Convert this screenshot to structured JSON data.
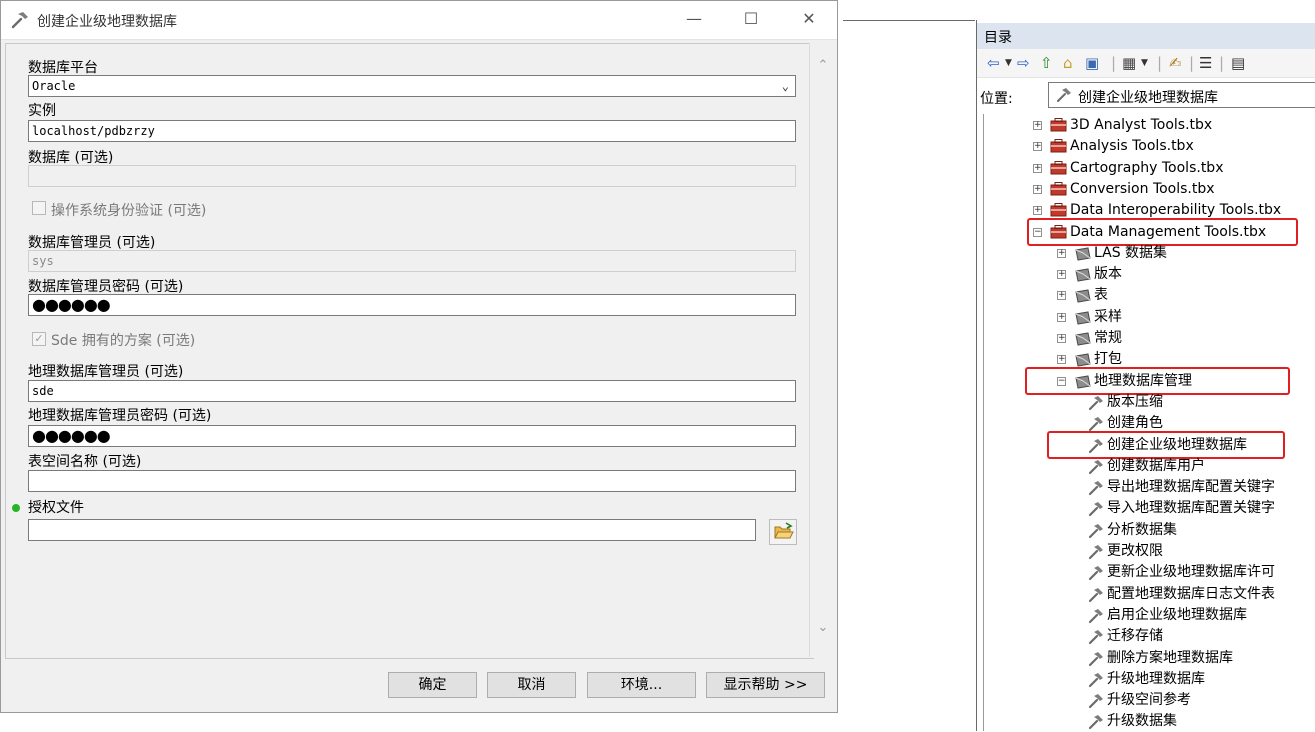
{
  "dialog": {
    "title": "创建企业级地理数据库",
    "window_buttons": [
      "—",
      "☐",
      "✕"
    ],
    "fields": {
      "platform_label": "数据库平台",
      "platform_value": "Oracle",
      "instance_label": "实例",
      "instance_value": "localhost/pdbzrzy",
      "database_label": "数据库 (可选)",
      "database_value": "",
      "os_auth_label": "操作系统身份验证 (可选)",
      "os_auth_checked": false,
      "dba_label": "数据库管理员 (可选)",
      "dba_value": "sys",
      "dba_pwd_label": "数据库管理员密码 (可选)",
      "dba_pwd_value": "●●●●●●",
      "sde_schema_label": "Sde 拥有的方案 (可选)",
      "sde_schema_checked": true,
      "gdb_admin_label": "地理数据库管理员 (可选)",
      "gdb_admin_value": "sde",
      "gdb_admin_pwd_label": "地理数据库管理员密码 (可选)",
      "gdb_admin_pwd_value": "●●●●●●",
      "tablespace_label": "表空间名称 (可选)",
      "tablespace_value": "",
      "auth_file_label": "授权文件",
      "auth_file_value": ""
    },
    "buttons": {
      "ok": "确定",
      "cancel": "取消",
      "env": "环境...",
      "help": "显示帮助 >>"
    }
  },
  "catalog": {
    "title": "目录",
    "location_label": "位置:",
    "location_value": "创建企业级地理数据库",
    "tree": [
      {
        "label": "3D Analyst Tools.tbx",
        "kind": "toolbox",
        "expander": "+"
      },
      {
        "label": "Analysis Tools.tbx",
        "kind": "toolbox",
        "expander": "+"
      },
      {
        "label": "Cartography Tools.tbx",
        "kind": "toolbox",
        "expander": "+"
      },
      {
        "label": "Conversion Tools.tbx",
        "kind": "toolbox",
        "expander": "+"
      },
      {
        "label": "Data Interoperability Tools.tbx",
        "kind": "toolbox",
        "expander": "+"
      },
      {
        "label": "Data Management Tools.tbx",
        "kind": "toolbox",
        "expander": "−",
        "highlighted": true
      },
      {
        "label": "LAS 数据集",
        "kind": "toolset",
        "expander": "+"
      },
      {
        "label": "版本",
        "kind": "toolset",
        "expander": "+"
      },
      {
        "label": "表",
        "kind": "toolset",
        "expander": "+"
      },
      {
        "label": "采样",
        "kind": "toolset",
        "expander": "+"
      },
      {
        "label": "常规",
        "kind": "toolset",
        "expander": "+"
      },
      {
        "label": "打包",
        "kind": "toolset",
        "expander": "+"
      },
      {
        "label": "地理数据库管理",
        "kind": "toolset",
        "expander": "−",
        "highlighted": true
      },
      {
        "label": "版本压缩",
        "kind": "tool"
      },
      {
        "label": "创建角色",
        "kind": "tool"
      },
      {
        "label": "创建企业级地理数据库",
        "kind": "tool",
        "highlighted": true
      },
      {
        "label": "创建数据库用户",
        "kind": "tool"
      },
      {
        "label": "导出地理数据库配置关键字",
        "kind": "tool"
      },
      {
        "label": "导入地理数据库配置关键字",
        "kind": "tool"
      },
      {
        "label": "分析数据集",
        "kind": "tool"
      },
      {
        "label": "更改权限",
        "kind": "tool"
      },
      {
        "label": "更新企业级地理数据库许可",
        "kind": "tool"
      },
      {
        "label": "配置地理数据库日志文件表",
        "kind": "tool"
      },
      {
        "label": "启用企业级地理数据库",
        "kind": "tool"
      },
      {
        "label": "迁移存储",
        "kind": "tool"
      },
      {
        "label": "删除方案地理数据库",
        "kind": "tool"
      },
      {
        "label": "升级地理数据库",
        "kind": "tool"
      },
      {
        "label": "升级空间参考",
        "kind": "tool"
      },
      {
        "label": "升级数据集",
        "kind": "tool"
      }
    ]
  },
  "colors": {
    "highlight": "#e02020",
    "required_dot": "#26b526",
    "catalog_header": "#dce4ef"
  }
}
